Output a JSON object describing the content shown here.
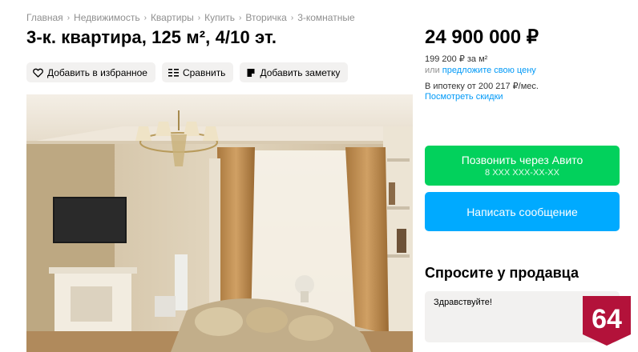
{
  "breadcrumbs": [
    "Главная",
    "Недвижимость",
    "Квартиры",
    "Купить",
    "Вторичка",
    "3-комнатные"
  ],
  "listing": {
    "title": "3-к. квартира, 125 м², 4/10 эт."
  },
  "actions": {
    "favorite_label": "Добавить в избранное",
    "compare_label": "Сравнить",
    "note_label": "Добавить заметку"
  },
  "price": {
    "total": "24 900 000 ₽",
    "per_meter": "199 200 ₽ за м²",
    "or_text": "или",
    "offer_link": "предложите свою цену",
    "mortgage": "В ипотеку от 200 217 ₽/мес.",
    "discounts_link": "Посмотреть скидки"
  },
  "contact": {
    "call_label": "Позвонить через Авито",
    "phone": "8 XXX XXX-XX-XX",
    "message_label": "Написать сообщение"
  },
  "ask": {
    "title": "Спросите у продавца",
    "message_text": "Здравствуйте!"
  },
  "badge": {
    "text": "64",
    "color": "#b3123a"
  },
  "colors": {
    "call_button": "#02d15c",
    "message_button": "#00aaff",
    "link": "#0099f7",
    "muted": "#8f8f8f"
  },
  "icons": [
    "heart-icon",
    "compare-icon",
    "note-icon"
  ]
}
